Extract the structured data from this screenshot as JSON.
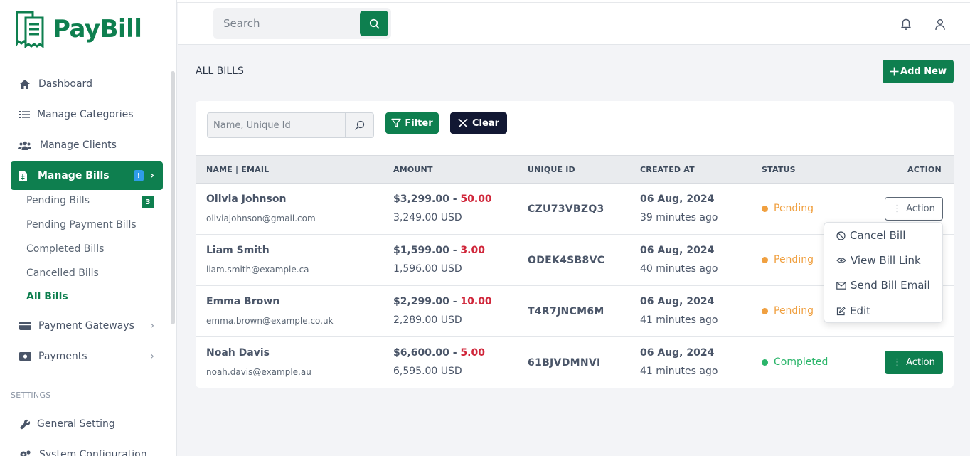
{
  "brand": {
    "name": "PayBill",
    "accent": "#0e7f4f"
  },
  "sidebar": {
    "items": [
      {
        "label": "Dashboard",
        "icon": "home-icon"
      },
      {
        "label": "Manage Categories",
        "icon": "list-icon"
      },
      {
        "label": "Manage Clients",
        "icon": "users-icon"
      },
      {
        "label": "Manage Bills",
        "icon": "file-icon",
        "badge": "!"
      },
      {
        "label": "Payment Gateways",
        "icon": "card-icon"
      },
      {
        "label": "Payments",
        "icon": "money-icon"
      }
    ],
    "bills_submenu": [
      {
        "label": "Pending Bills",
        "count": "3"
      },
      {
        "label": "Pending Payment Bills"
      },
      {
        "label": "Completed Bills"
      },
      {
        "label": "Cancelled Bills"
      },
      {
        "label": "All Bills"
      }
    ],
    "settings_heading": "SETTINGS",
    "settings_items": [
      {
        "label": "General Setting",
        "icon": "wrench-icon"
      },
      {
        "label": "System Configuration",
        "icon": "cogs-icon"
      }
    ]
  },
  "search": {
    "placeholder": "Search"
  },
  "page": {
    "title": "ALL BILLS",
    "add_label": "Add New",
    "filter_placeholder": "Name, Unique Id",
    "filter_label": "Filter",
    "clear_label": "Clear"
  },
  "table": {
    "columns": [
      "NAME | EMAIL",
      "AMOUNT",
      "UNIQUE ID",
      "CREATED AT",
      "STATUS",
      "ACTION"
    ],
    "rows": [
      {
        "name": "Olivia Johnson",
        "email": "oliviajohnson@gmail.com",
        "amount": "$3,299.00 - ",
        "fee": "50.00",
        "net": "3,249.00 USD",
        "uid": "CZU73VBZQ3",
        "date": "06 Aug, 2024",
        "ago": "39 minutes ago",
        "status": "Pending",
        "action": "Action"
      },
      {
        "name": "Liam Smith",
        "email": "liam.smith@example.ca",
        "amount": "$1,599.00 - ",
        "fee": "3.00",
        "net": "1,596.00 USD",
        "uid": "ODEK4SB8VC",
        "date": "06 Aug, 2024",
        "ago": "40 minutes ago",
        "status": "Pending",
        "action": "Action"
      },
      {
        "name": "Emma Brown",
        "email": "emma.brown@example.co.uk",
        "amount": "$2,299.00 - ",
        "fee": "10.00",
        "net": "2,289.00 USD",
        "uid": "T4R7JNCM6M",
        "date": "06 Aug, 2024",
        "ago": "41 minutes ago",
        "status": "Pending",
        "action": "Action"
      },
      {
        "name": "Noah Davis",
        "email": "noah.davis@example.au",
        "amount": "$6,600.00 - ",
        "fee": "5.00",
        "net": "6,595.00 USD",
        "uid": "61BJVDMNVI",
        "date": "06 Aug, 2024",
        "ago": "41 minutes ago",
        "status": "Completed",
        "action": "Action"
      }
    ]
  },
  "action_menu": [
    {
      "label": "Cancel Bill",
      "icon": "ban-icon"
    },
    {
      "label": "View Bill Link",
      "icon": "eye-icon"
    },
    {
      "label": "Send Bill Email",
      "icon": "mail-icon"
    },
    {
      "label": "Edit",
      "icon": "edit-icon"
    }
  ],
  "colors": {
    "pending": "#f0a040",
    "completed": "#2bb56a",
    "fee": "#d0263a"
  }
}
